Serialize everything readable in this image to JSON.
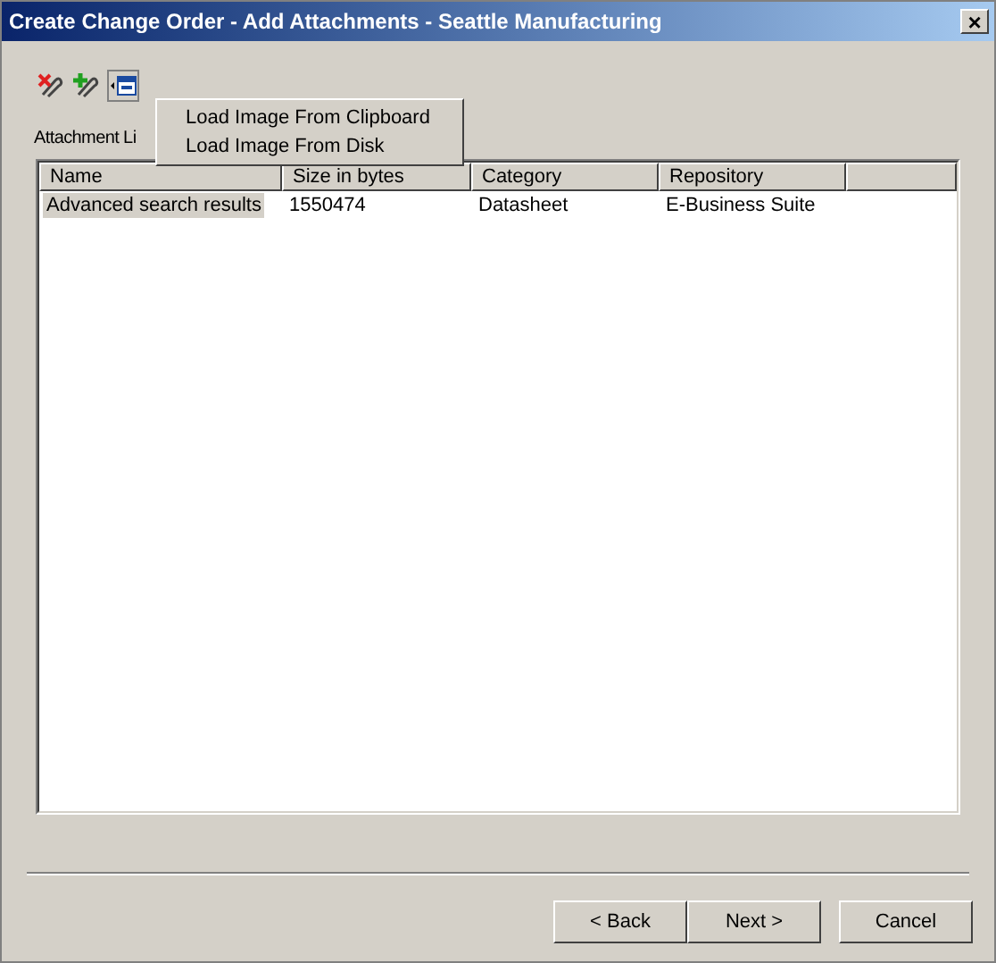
{
  "window": {
    "title": "Create Change Order - Add Attachments - Seattle Manufacturing",
    "close": "×"
  },
  "toolbar": [
    {
      "kind": "remove"
    },
    {
      "kind": "add"
    },
    {
      "kind": "image"
    }
  ],
  "attachment_label": "Attachment Li",
  "menu": [
    "Load Image From Clipboard",
    "Load Image From Disk"
  ],
  "table": {
    "columns": [
      "Name",
      "Size in bytes",
      "Category",
      "Repository"
    ],
    "rows": [
      {
        "selected": true,
        "cells": [
          "Advanced search results",
          "1550474",
          "Datasheet",
          "E-Business Suite"
        ]
      }
    ]
  },
  "buttons": [
    {
      "label": "< Back"
    },
    {
      "label": "Next >"
    },
    {
      "label": "Cancel"
    }
  ]
}
